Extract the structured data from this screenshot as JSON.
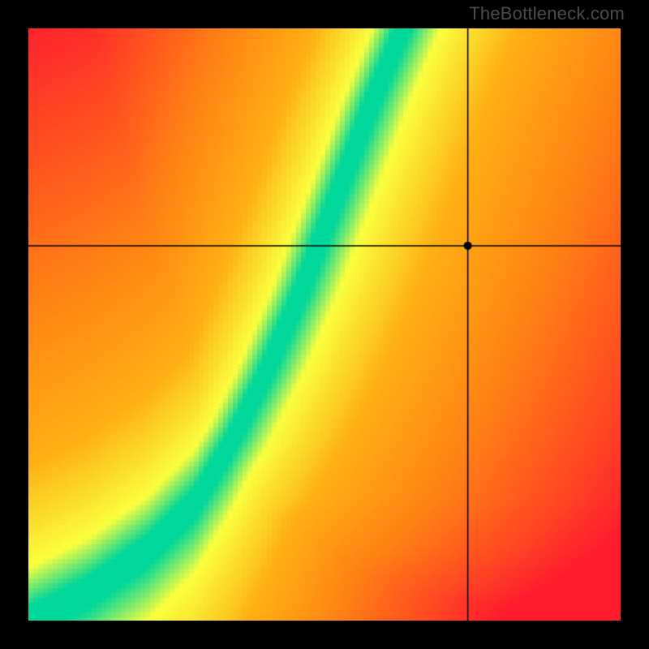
{
  "watermark": "TheBottleneck.com",
  "chart_data": {
    "type": "heatmap",
    "title": "",
    "xlabel": "",
    "ylabel": "",
    "xlim": [
      0,
      1
    ],
    "ylim": [
      0,
      1
    ],
    "grid": false,
    "legend": false,
    "ridge": {
      "description": "Optimal (green) curve approximated as y vs x breakpoints, normalized 0..1 from bottom-left.",
      "points": [
        [
          0.0,
          0.0
        ],
        [
          0.1,
          0.05
        ],
        [
          0.2,
          0.12
        ],
        [
          0.28,
          0.2
        ],
        [
          0.34,
          0.3
        ],
        [
          0.4,
          0.42
        ],
        [
          0.46,
          0.56
        ],
        [
          0.52,
          0.72
        ],
        [
          0.58,
          0.88
        ],
        [
          0.63,
          1.0
        ]
      ],
      "width_scale": 0.055
    },
    "crosshair": {
      "x": 0.742,
      "y": 0.633
    },
    "colors": {
      "best": "#00d79b",
      "good": "#faff3e",
      "mid": "#ffb014",
      "bad": "#ff7e15",
      "worst": "#ff1c2e"
    }
  }
}
